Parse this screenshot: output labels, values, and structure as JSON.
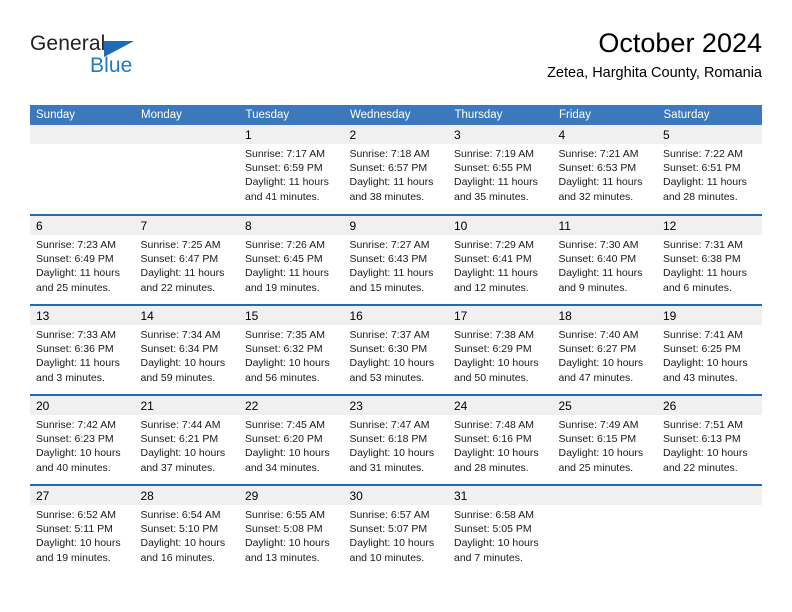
{
  "brand": {
    "logo_text_1": "General",
    "logo_text_2": "Blue",
    "logo_accent_color": "#1f7ac4"
  },
  "header": {
    "title": "October 2024",
    "subtitle": "Zetea, Harghita County, Romania"
  },
  "theme": {
    "header_bg": "#3b78bc",
    "week_divider": "#1f6cb2",
    "daynum_band_bg": "#f0f0f0"
  },
  "weekday_headers": [
    "Sunday",
    "Monday",
    "Tuesday",
    "Wednesday",
    "Thursday",
    "Friday",
    "Saturday"
  ],
  "weeks": [
    [
      {
        "day": "",
        "sunrise": "",
        "sunset": "",
        "daylight": ""
      },
      {
        "day": "",
        "sunrise": "",
        "sunset": "",
        "daylight": ""
      },
      {
        "day": "1",
        "sunrise": "Sunrise: 7:17 AM",
        "sunset": "Sunset: 6:59 PM",
        "daylight": "Daylight: 11 hours and 41 minutes."
      },
      {
        "day": "2",
        "sunrise": "Sunrise: 7:18 AM",
        "sunset": "Sunset: 6:57 PM",
        "daylight": "Daylight: 11 hours and 38 minutes."
      },
      {
        "day": "3",
        "sunrise": "Sunrise: 7:19 AM",
        "sunset": "Sunset: 6:55 PM",
        "daylight": "Daylight: 11 hours and 35 minutes."
      },
      {
        "day": "4",
        "sunrise": "Sunrise: 7:21 AM",
        "sunset": "Sunset: 6:53 PM",
        "daylight": "Daylight: 11 hours and 32 minutes."
      },
      {
        "day": "5",
        "sunrise": "Sunrise: 7:22 AM",
        "sunset": "Sunset: 6:51 PM",
        "daylight": "Daylight: 11 hours and 28 minutes."
      }
    ],
    [
      {
        "day": "6",
        "sunrise": "Sunrise: 7:23 AM",
        "sunset": "Sunset: 6:49 PM",
        "daylight": "Daylight: 11 hours and 25 minutes."
      },
      {
        "day": "7",
        "sunrise": "Sunrise: 7:25 AM",
        "sunset": "Sunset: 6:47 PM",
        "daylight": "Daylight: 11 hours and 22 minutes."
      },
      {
        "day": "8",
        "sunrise": "Sunrise: 7:26 AM",
        "sunset": "Sunset: 6:45 PM",
        "daylight": "Daylight: 11 hours and 19 minutes."
      },
      {
        "day": "9",
        "sunrise": "Sunrise: 7:27 AM",
        "sunset": "Sunset: 6:43 PM",
        "daylight": "Daylight: 11 hours and 15 minutes."
      },
      {
        "day": "10",
        "sunrise": "Sunrise: 7:29 AM",
        "sunset": "Sunset: 6:41 PM",
        "daylight": "Daylight: 11 hours and 12 minutes."
      },
      {
        "day": "11",
        "sunrise": "Sunrise: 7:30 AM",
        "sunset": "Sunset: 6:40 PM",
        "daylight": "Daylight: 11 hours and 9 minutes."
      },
      {
        "day": "12",
        "sunrise": "Sunrise: 7:31 AM",
        "sunset": "Sunset: 6:38 PM",
        "daylight": "Daylight: 11 hours and 6 minutes."
      }
    ],
    [
      {
        "day": "13",
        "sunrise": "Sunrise: 7:33 AM",
        "sunset": "Sunset: 6:36 PM",
        "daylight": "Daylight: 11 hours and 3 minutes."
      },
      {
        "day": "14",
        "sunrise": "Sunrise: 7:34 AM",
        "sunset": "Sunset: 6:34 PM",
        "daylight": "Daylight: 10 hours and 59 minutes."
      },
      {
        "day": "15",
        "sunrise": "Sunrise: 7:35 AM",
        "sunset": "Sunset: 6:32 PM",
        "daylight": "Daylight: 10 hours and 56 minutes."
      },
      {
        "day": "16",
        "sunrise": "Sunrise: 7:37 AM",
        "sunset": "Sunset: 6:30 PM",
        "daylight": "Daylight: 10 hours and 53 minutes."
      },
      {
        "day": "17",
        "sunrise": "Sunrise: 7:38 AM",
        "sunset": "Sunset: 6:29 PM",
        "daylight": "Daylight: 10 hours and 50 minutes."
      },
      {
        "day": "18",
        "sunrise": "Sunrise: 7:40 AM",
        "sunset": "Sunset: 6:27 PM",
        "daylight": "Daylight: 10 hours and 47 minutes."
      },
      {
        "day": "19",
        "sunrise": "Sunrise: 7:41 AM",
        "sunset": "Sunset: 6:25 PM",
        "daylight": "Daylight: 10 hours and 43 minutes."
      }
    ],
    [
      {
        "day": "20",
        "sunrise": "Sunrise: 7:42 AM",
        "sunset": "Sunset: 6:23 PM",
        "daylight": "Daylight: 10 hours and 40 minutes."
      },
      {
        "day": "21",
        "sunrise": "Sunrise: 7:44 AM",
        "sunset": "Sunset: 6:21 PM",
        "daylight": "Daylight: 10 hours and 37 minutes."
      },
      {
        "day": "22",
        "sunrise": "Sunrise: 7:45 AM",
        "sunset": "Sunset: 6:20 PM",
        "daylight": "Daylight: 10 hours and 34 minutes."
      },
      {
        "day": "23",
        "sunrise": "Sunrise: 7:47 AM",
        "sunset": "Sunset: 6:18 PM",
        "daylight": "Daylight: 10 hours and 31 minutes."
      },
      {
        "day": "24",
        "sunrise": "Sunrise: 7:48 AM",
        "sunset": "Sunset: 6:16 PM",
        "daylight": "Daylight: 10 hours and 28 minutes."
      },
      {
        "day": "25",
        "sunrise": "Sunrise: 7:49 AM",
        "sunset": "Sunset: 6:15 PM",
        "daylight": "Daylight: 10 hours and 25 minutes."
      },
      {
        "day": "26",
        "sunrise": "Sunrise: 7:51 AM",
        "sunset": "Sunset: 6:13 PM",
        "daylight": "Daylight: 10 hours and 22 minutes."
      }
    ],
    [
      {
        "day": "27",
        "sunrise": "Sunrise: 6:52 AM",
        "sunset": "Sunset: 5:11 PM",
        "daylight": "Daylight: 10 hours and 19 minutes."
      },
      {
        "day": "28",
        "sunrise": "Sunrise: 6:54 AM",
        "sunset": "Sunset: 5:10 PM",
        "daylight": "Daylight: 10 hours and 16 minutes."
      },
      {
        "day": "29",
        "sunrise": "Sunrise: 6:55 AM",
        "sunset": "Sunset: 5:08 PM",
        "daylight": "Daylight: 10 hours and 13 minutes."
      },
      {
        "day": "30",
        "sunrise": "Sunrise: 6:57 AM",
        "sunset": "Sunset: 5:07 PM",
        "daylight": "Daylight: 10 hours and 10 minutes."
      },
      {
        "day": "31",
        "sunrise": "Sunrise: 6:58 AM",
        "sunset": "Sunset: 5:05 PM",
        "daylight": "Daylight: 10 hours and 7 minutes."
      },
      {
        "day": "",
        "sunrise": "",
        "sunset": "",
        "daylight": ""
      },
      {
        "day": "",
        "sunrise": "",
        "sunset": "",
        "daylight": ""
      }
    ]
  ]
}
